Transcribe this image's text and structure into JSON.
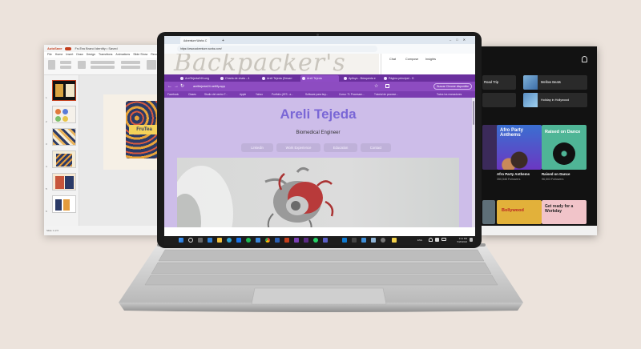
{
  "ppt": {
    "autosave": "AutoSave",
    "filename": "FruTea Brand Identity • Saved",
    "menu": [
      "File",
      "Home",
      "Insert",
      "Draw",
      "Design",
      "Transitions",
      "Animations",
      "Slide Show",
      "Record",
      "Review"
    ],
    "slide_text": "FruTea"
  },
  "music": {
    "rows": [
      "Road Trip",
      "Mellow Beats",
      "Holiday in Hollywood"
    ],
    "cards": [
      {
        "title": "Afro Party Anthems",
        "sub": "350,546 Followers",
        "art": "Afro Party Anthems"
      },
      {
        "title": "Raised on Dance",
        "sub": "96,503 Followers",
        "art": "Raised on Dance"
      }
    ],
    "bottom_cards": [
      "Bollywood",
      "Get ready for a Workday"
    ]
  },
  "back_browser": {
    "tabs": [
      "Adventure Works C",
      "Charla de chats - 4"
    ],
    "url": "https://www.adventure-works.com/",
    "hero": "Backpacker's",
    "copilot": [
      "Chat",
      "Compose",
      "Insights"
    ]
  },
  "browser": {
    "tabs": [
      {
        "label": "ArelTejeda24/Lung",
        "active": false
      },
      {
        "label": "Charla de chats - 4",
        "active": false
      },
      {
        "label": "Areli Tejeda (Desarr",
        "active": false
      },
      {
        "label": "Areli Tejeda",
        "active": true
      },
      {
        "label": "Aplisys - Búsqueda e",
        "active": false
      },
      {
        "label": "Página principal - G",
        "active": false
      }
    ],
    "url": "arelitejeda24.netlify.app",
    "signin": "Buscar Chrome disponible",
    "bookmarks": [
      "Facebook",
      "Clases",
      "Studio del centro T...",
      "Apple",
      "Yahoo",
      "Portfolio (ATS - a...",
      "Software para buy...",
      "Curso: 71 Procesam...",
      "Tutorial de procese...",
      "Todos los marcadores"
    ]
  },
  "page": {
    "name": "Areli Tejeda",
    "subtitle": "Biomedical Engineer",
    "buttons": [
      "Linkedin",
      "Work Experience",
      "Education",
      "Contact"
    ]
  },
  "taskbar": {
    "lang": "ENG",
    "time": "3:11 PM",
    "date": "5/26/2024"
  },
  "colors": {
    "accent": "#7a67d6",
    "page_bg": "#cdbde9",
    "tab_bar": "#6a2f9e"
  }
}
